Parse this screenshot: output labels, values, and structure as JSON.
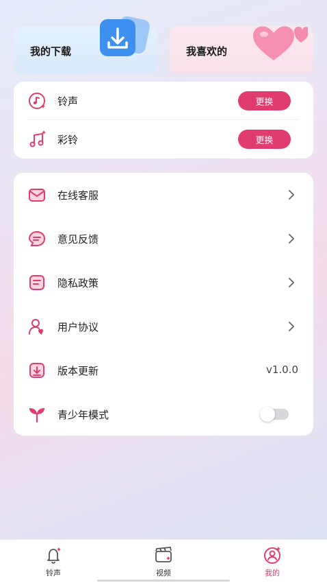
{
  "top_cards": {
    "download_label": "我的下载",
    "favorite_label": "我喜欢的"
  },
  "ring_section": {
    "items": [
      {
        "label": "铃声",
        "button": "更换"
      },
      {
        "label": "彩铃",
        "button": "更换"
      }
    ]
  },
  "menu": {
    "items": [
      {
        "label": "在线客服"
      },
      {
        "label": "意见反馈"
      },
      {
        "label": "隐私政策"
      },
      {
        "label": "用户协议"
      },
      {
        "label": "版本更新",
        "value": "v1.0.0"
      },
      {
        "label": "青少年模式",
        "toggle_on": false
      }
    ]
  },
  "tabbar": {
    "tabs": [
      {
        "label": "铃声"
      },
      {
        "label": "视频"
      },
      {
        "label": "我的",
        "active": true
      }
    ]
  },
  "colors": {
    "accent": "#e13c6f",
    "download_card": "#dfeefc",
    "favorite_card": "#fae4ee"
  }
}
